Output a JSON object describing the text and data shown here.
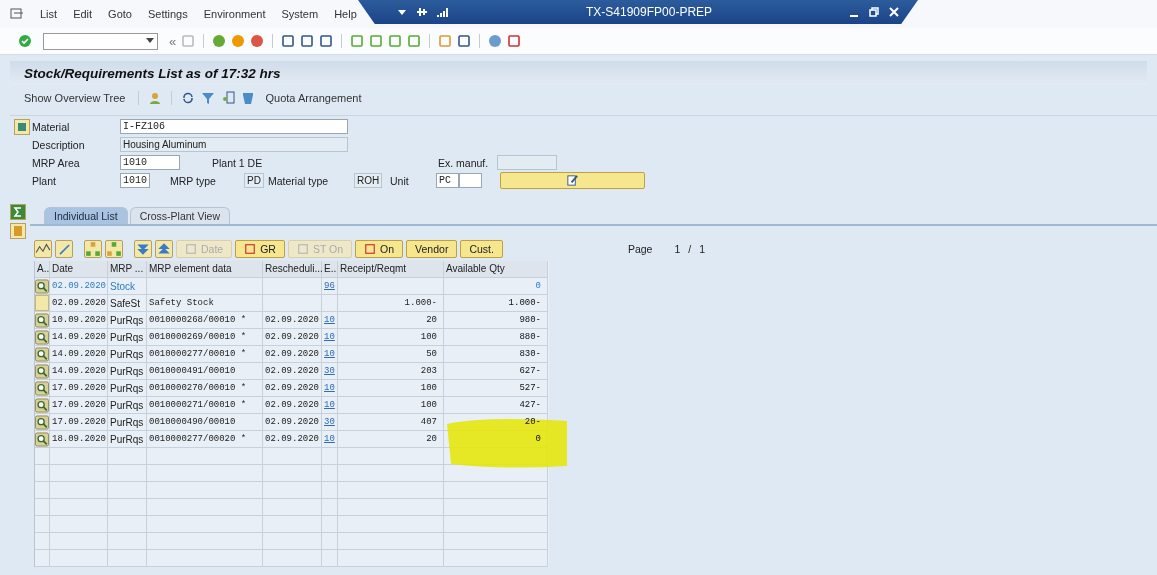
{
  "menu": [
    "List",
    "Edit",
    "Goto",
    "Settings",
    "Environment",
    "System",
    "Help"
  ],
  "window": {
    "title": "TX-S41909FP00-PREP"
  },
  "toolbar": {
    "collapse": "«"
  },
  "screen_title": "Stock/Requirements List as of 17:32 hrs",
  "app_toolbar": {
    "overview_tree": "Show Overview Tree",
    "quota": "Quota Arrangement"
  },
  "header": {
    "material_label": "Material",
    "material": "I-FZ106",
    "description_label": "Description",
    "description": "Housing Aluminum",
    "mrp_area_label": "MRP Area",
    "mrp_area": "1010",
    "mrp_area_text": "Plant 1 DE",
    "ex_manuf_label": "Ex. manuf.",
    "plant_label": "Plant",
    "plant": "1010",
    "mrp_type_label": "MRP type",
    "mrp_type": "PD",
    "material_type_label": "Material type",
    "material_type": "ROH",
    "unit_label": "Unit",
    "unit": "PC"
  },
  "tabs": [
    {
      "label": "Individual List",
      "selected": true
    },
    {
      "label": "Cross-Plant View",
      "selected": false
    }
  ],
  "list_buttons": [
    {
      "label": "Date",
      "disabled": true
    },
    {
      "label": "GR",
      "disabled": false
    },
    {
      "label": "ST On",
      "disabled": true
    },
    {
      "label": "On",
      "disabled": false
    },
    {
      "label": "Vendor",
      "disabled": false
    },
    {
      "label": "Cust.",
      "disabled": false
    }
  ],
  "page": {
    "label": "Page",
    "current": "1",
    "separator": "/",
    "total": "1"
  },
  "table": {
    "columns": [
      "A..",
      "Date",
      "MRP ...",
      "MRP element data",
      "Rescheduli...",
      "E..",
      "Receipt/Reqmt",
      "Available Qty"
    ],
    "rows": [
      {
        "kind": "stock",
        "date": "02.09.2020",
        "mrp": "Stock",
        "element": "",
        "reschedule": "",
        "exception": "96",
        "receipt": "",
        "available": "0"
      },
      {
        "kind": "safety",
        "date": "02.09.2020",
        "mrp": "SafeSt",
        "element": "Safety Stock",
        "reschedule": "",
        "exception": "",
        "receipt": "1.000-",
        "available": "1.000-"
      },
      {
        "kind": "item",
        "date": "10.09.2020",
        "mrp": "PurRqs",
        "element": "0010000268/00010 *",
        "reschedule": "02.09.2020",
        "exception": "10",
        "receipt": "20",
        "available": "980-"
      },
      {
        "kind": "item",
        "date": "14.09.2020",
        "mrp": "PurRqs",
        "element": "0010000269/00010 *",
        "reschedule": "02.09.2020",
        "exception": "10",
        "receipt": "100",
        "available": "880-"
      },
      {
        "kind": "item",
        "date": "14.09.2020",
        "mrp": "PurRqs",
        "element": "0010000277/00010 *",
        "reschedule": "02.09.2020",
        "exception": "10",
        "receipt": "50",
        "available": "830-"
      },
      {
        "kind": "item",
        "date": "14.09.2020",
        "mrp": "PurRqs",
        "element": "0010000491/00010",
        "reschedule": "02.09.2020",
        "exception": "30",
        "receipt": "203",
        "available": "627-"
      },
      {
        "kind": "item",
        "date": "17.09.2020",
        "mrp": "PurRqs",
        "element": "0010000270/00010 *",
        "reschedule": "02.09.2020",
        "exception": "10",
        "receipt": "100",
        "available": "527-"
      },
      {
        "kind": "item",
        "date": "17.09.2020",
        "mrp": "PurRqs",
        "element": "0010000271/00010 *",
        "reschedule": "02.09.2020",
        "exception": "10",
        "receipt": "100",
        "available": "427-"
      },
      {
        "kind": "item",
        "date": "17.09.2020",
        "mrp": "PurRqs",
        "element": "0010000490/00010",
        "reschedule": "02.09.2020",
        "exception": "30",
        "receipt": "407",
        "available": "20-"
      },
      {
        "kind": "item",
        "date": "18.09.2020",
        "mrp": "PurRqs",
        "element": "0010000277/00020 *",
        "reschedule": "02.09.2020",
        "exception": "10",
        "receipt": "20",
        "available": "0"
      }
    ]
  }
}
